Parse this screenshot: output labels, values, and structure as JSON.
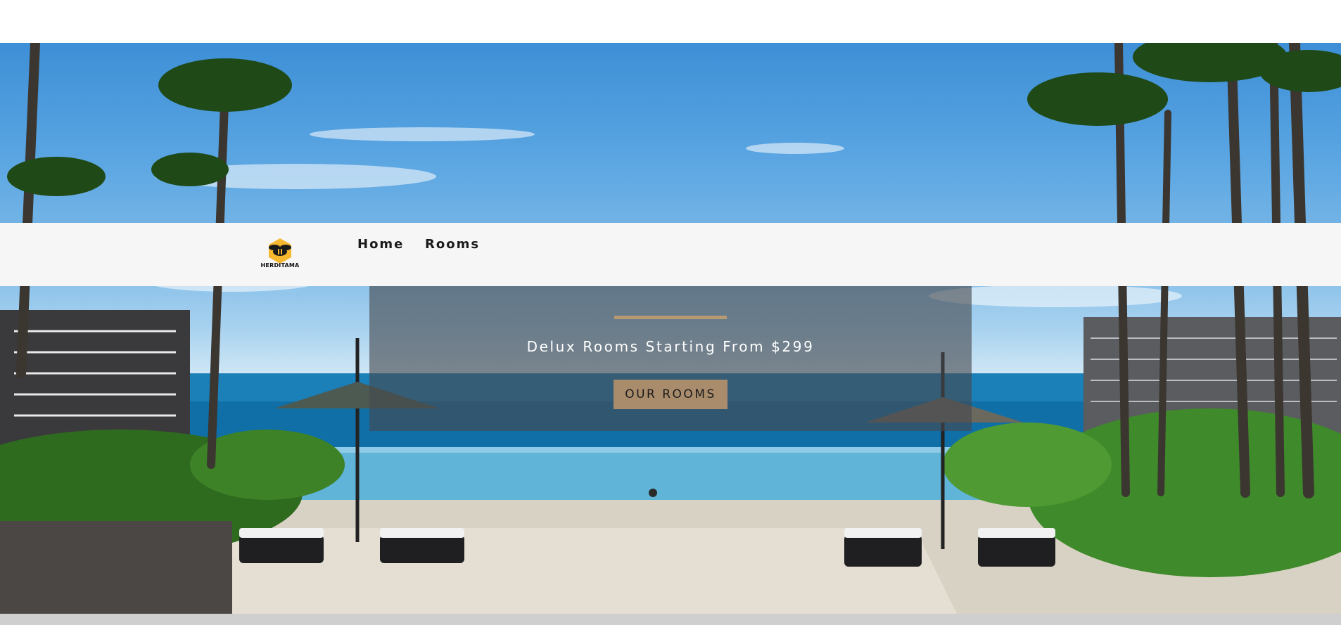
{
  "brand": {
    "logo_text": "HERDITAMA"
  },
  "nav": {
    "items": [
      {
        "label": "Home"
      },
      {
        "label": "Rooms"
      }
    ]
  },
  "hero": {
    "subtitle": "Delux Rooms Starting From $299",
    "cta_label": "OUR ROOMS"
  },
  "colors": {
    "accent": "#b89a72",
    "button_bg": "#a98c6c",
    "navbar_bg": "#f6f6f6",
    "logo_hex": "#f5b82e"
  },
  "icons": {
    "logo": "bee-hexagon-icon"
  }
}
